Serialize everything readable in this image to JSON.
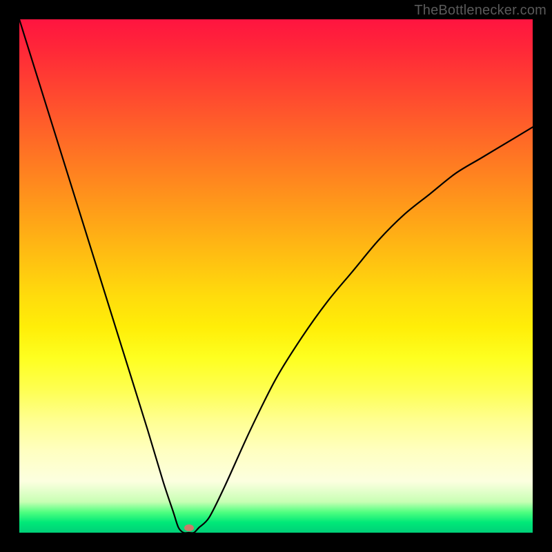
{
  "watermark": {
    "text": "TheBottlenecker.com"
  },
  "chart_data": {
    "type": "line",
    "title": "",
    "xlabel": "",
    "ylabel": "",
    "xlim": [
      0,
      100
    ],
    "ylim": [
      0,
      100
    ],
    "x": [
      0,
      5,
      10,
      15,
      20,
      25,
      28,
      30,
      31,
      32,
      33,
      34,
      35,
      37,
      40,
      45,
      50,
      55,
      60,
      65,
      70,
      75,
      80,
      85,
      90,
      95,
      100
    ],
    "values": [
      100,
      84,
      68,
      52,
      36,
      20,
      10,
      4,
      1,
      0,
      0,
      0,
      1,
      3,
      9,
      20,
      30,
      38,
      45,
      51,
      57,
      62,
      66,
      70,
      73,
      76,
      79
    ],
    "marker": {
      "x": 33,
      "y": 1,
      "color": "#c97b6a"
    },
    "gradient_stops": [
      {
        "pct": 0,
        "color": "#ff1440"
      },
      {
        "pct": 50,
        "color": "#ffdc0c"
      },
      {
        "pct": 85,
        "color": "#ffffd0"
      },
      {
        "pct": 100,
        "color": "#00d078"
      }
    ],
    "grid": false,
    "legend": false
  },
  "colors": {
    "frame": "#000000",
    "watermark": "#5a5a5a",
    "curve": "#000000"
  }
}
